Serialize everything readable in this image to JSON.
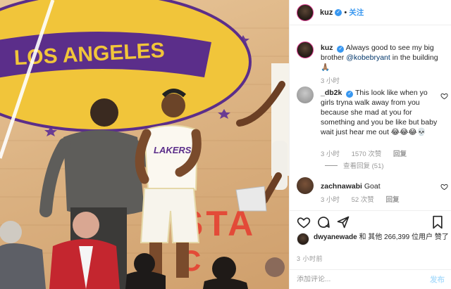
{
  "header": {
    "username": "kuz",
    "follow_label": "关注"
  },
  "comments": [
    {
      "username": "kuz",
      "text": "Always good to see my big brother",
      "mention": "@kobebryant",
      "text_after": "in the building 🙏🏽",
      "time": "3 小时"
    },
    {
      "username": "_db2k",
      "text": "This look like when yo girls tryna walk away from you because she mad at you for something and you be like but baby wait just hear me out 😂😂😂💀",
      "time": "3 小时",
      "likes": "1570 次赞",
      "reply_label": "回复",
      "view_replies": "查看回复 (51)"
    },
    {
      "username": "zachnawabi",
      "text": "Goat",
      "time": "3 小时",
      "likes": "52 次赞",
      "reply_label": "回复"
    }
  ],
  "likes_line": {
    "liker": "dwyanewade",
    "text": "和 其他 266,399 位用户 赞了"
  },
  "timestamp": "3 小时前",
  "add_comment": {
    "placeholder": "添加评论...",
    "post_label": "发布"
  },
  "photo": {
    "court_text_top": "LOS ANGELES",
    "court_text_bottom": "STAPLES CENTER",
    "jersey_text": "LAKERS"
  },
  "colors": {
    "accent": "#3897f0",
    "court_gold": "#f1c53a",
    "court_purple": "#5b2e8a",
    "court_red": "#e63b2e"
  },
  "icons": [
    "heart-icon",
    "comment-icon",
    "share-icon",
    "bookmark-icon",
    "verified-icon"
  ]
}
